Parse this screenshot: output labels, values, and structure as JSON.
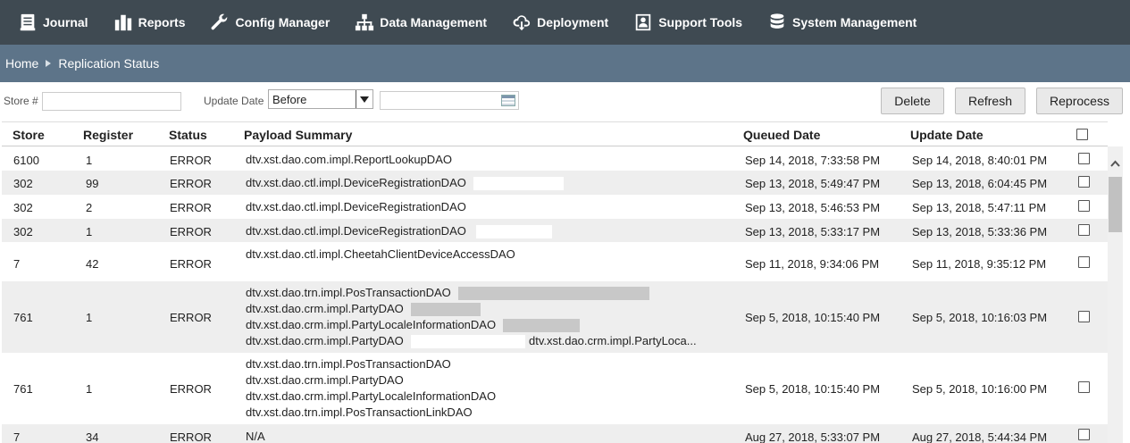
{
  "nav": {
    "items": [
      {
        "label": "Journal",
        "icon": "journal-icon"
      },
      {
        "label": "Reports",
        "icon": "bar-chart-icon"
      },
      {
        "label": "Config Manager",
        "icon": "wrench-icon"
      },
      {
        "label": "Data Management",
        "icon": "hierarchy-icon"
      },
      {
        "label": "Deployment",
        "icon": "cloud-download-icon"
      },
      {
        "label": "Support Tools",
        "icon": "support-icon"
      },
      {
        "label": "System Management",
        "icon": "database-icon"
      }
    ]
  },
  "breadcrumb": {
    "home": "Home",
    "current": "Replication Status"
  },
  "filters": {
    "store_label": "Store #",
    "store_value": "",
    "update_date_label": "Update Date",
    "update_date_mode": "Before",
    "update_date_value": ""
  },
  "actions": {
    "delete": "Delete",
    "refresh": "Refresh",
    "reprocess": "Reprocess"
  },
  "table": {
    "headers": {
      "store": "Store",
      "register": "Register",
      "status": "Status",
      "payload": "Payload Summary",
      "queued": "Queued Date",
      "update": "Update Date"
    },
    "rows": [
      {
        "store": "6100",
        "register": "1",
        "status": "ERROR",
        "payload": [
          "dtv.xst.dao.com.impl.ReportLookupDAO"
        ],
        "queued": "Sep 14, 2018, 7:33:58 PM",
        "update": "Sep 14, 2018, 8:40:01 PM"
      },
      {
        "store": "302",
        "register": "99",
        "status": "ERROR",
        "payload": [
          "dtv.xst.dao.ctl.impl.DeviceRegistrationDAO"
        ],
        "queued": "Sep 13, 2018, 5:49:47 PM",
        "update": "Sep 13, 2018, 6:04:45 PM"
      },
      {
        "store": "302",
        "register": "2",
        "status": "ERROR",
        "payload": [
          "dtv.xst.dao.ctl.impl.DeviceRegistrationDAO"
        ],
        "queued": "Sep 13, 2018, 5:46:53 PM",
        "update": "Sep 13, 2018, 5:47:11 PM"
      },
      {
        "store": "302",
        "register": "1",
        "status": "ERROR",
        "payload": [
          "dtv.xst.dao.ctl.impl.DeviceRegistrationDAO"
        ],
        "queued": "Sep 13, 2018, 5:33:17 PM",
        "update": "Sep 13, 2018, 5:33:36 PM"
      },
      {
        "store": "7",
        "register": "42",
        "status": "ERROR",
        "payload": [
          "dtv.xst.dao.ctl.impl.CheetahClientDeviceAccessDAO"
        ],
        "queued": "Sep 11, 2018, 9:34:06 PM",
        "update": "Sep 11, 2018, 9:35:12 PM"
      },
      {
        "store": "761",
        "register": "1",
        "status": "ERROR",
        "payload": [
          "dtv.xst.dao.trn.impl.PosTransactionDAO",
          "dtv.xst.dao.crm.impl.PartyDAO",
          "dtv.xst.dao.crm.impl.PartyLocaleInformationDAO",
          "dtv.xst.dao.crm.impl.PartyDAO"
        ],
        "payload_tail": "dtv.xst.dao.crm.impl.PartyLoca...",
        "queued": "Sep 5, 2018, 10:15:40 PM",
        "update": "Sep 5, 2018, 10:16:03 PM"
      },
      {
        "store": "761",
        "register": "1",
        "status": "ERROR",
        "payload": [
          "dtv.xst.dao.trn.impl.PosTransactionDAO",
          "dtv.xst.dao.crm.impl.PartyDAO",
          "dtv.xst.dao.crm.impl.PartyLocaleInformationDAO",
          "dtv.xst.dao.trn.impl.PosTransactionLinkDAO"
        ],
        "queued": "Sep 5, 2018, 10:15:40 PM",
        "update": "Sep 5, 2018, 10:16:00 PM"
      },
      {
        "store": "7",
        "register": "34",
        "status": "ERROR",
        "payload": [
          "N/A"
        ],
        "queued": "Aug 27, 2018, 5:33:07 PM",
        "update": "Aug 27, 2018, 5:44:34 PM"
      }
    ]
  }
}
